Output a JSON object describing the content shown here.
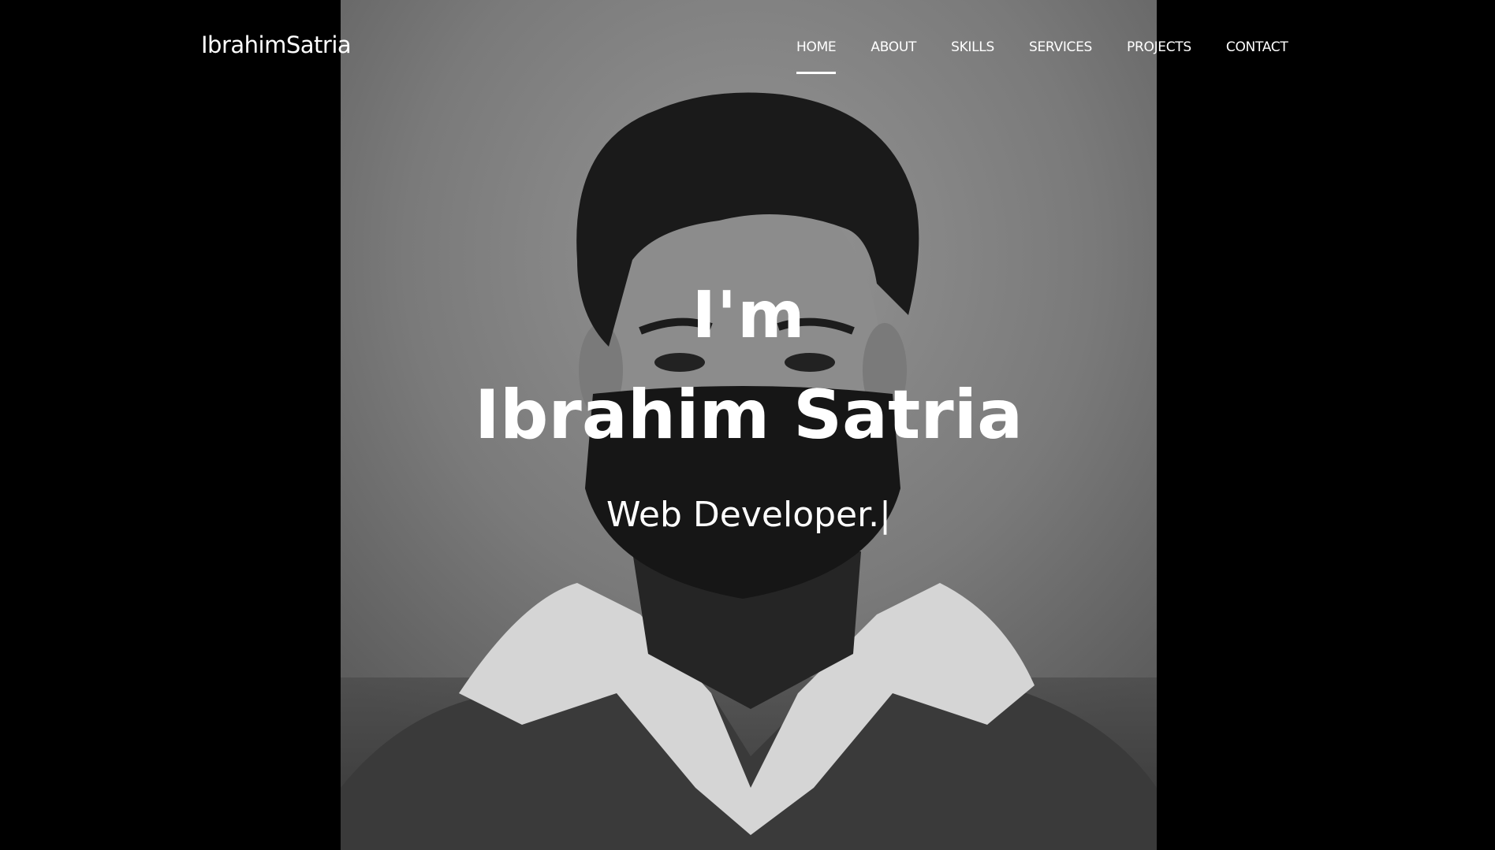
{
  "header": {
    "logo": "IbrahimSatria",
    "nav": [
      {
        "label": "HOME",
        "active": true
      },
      {
        "label": "ABOUT",
        "active": false
      },
      {
        "label": "SKILLS",
        "active": false
      },
      {
        "label": "SERVICES",
        "active": false
      },
      {
        "label": "PROJECTS",
        "active": false
      },
      {
        "label": "CONTACT",
        "active": false
      }
    ]
  },
  "hero": {
    "greeting": "I'm",
    "name": "Ibrahim Satria",
    "role": "Web Developer.|"
  },
  "colors": {
    "background": "#000000",
    "text": "#ffffff",
    "photo_tone": "#777777"
  }
}
